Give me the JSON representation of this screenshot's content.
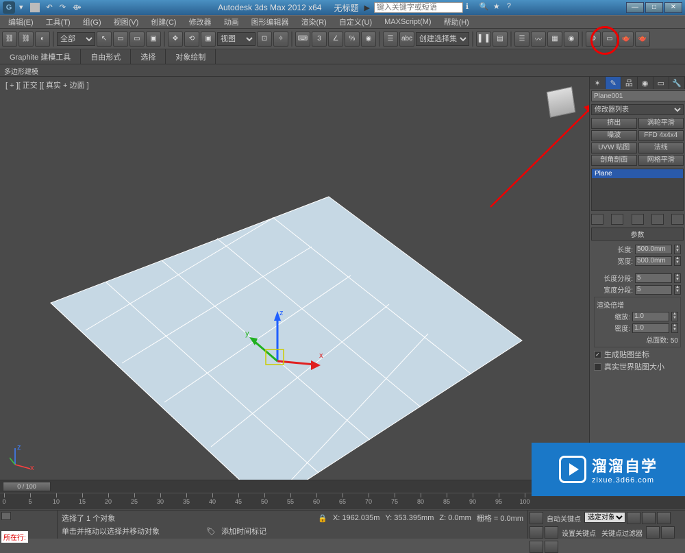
{
  "title": {
    "app": "Autodesk 3ds Max 2012 x64",
    "doc": "无标题",
    "search_placeholder": "键入关键字或短语"
  },
  "menu": [
    "编辑(E)",
    "工具(T)",
    "组(G)",
    "视图(V)",
    "创建(C)",
    "修改器",
    "动画",
    "图形编辑器",
    "渲染(R)",
    "自定义(U)",
    "MAXScript(M)",
    "帮助(H)"
  ],
  "toolbar": {
    "filter": "全部",
    "viewsel": "视图",
    "setdd": "创建选择集"
  },
  "ribbon": {
    "tabs": [
      "Graphite 建模工具",
      "自由形式",
      "选择",
      "对象绘制"
    ],
    "sub": "多边形建模"
  },
  "viewport": {
    "label": "[ + ][ 正交 ][ 真实 + 边面 ]"
  },
  "panel": {
    "objname": "Plane001",
    "modlist": "修改器列表",
    "mods": [
      "挤出",
      "涡轮平滑",
      "噪波",
      "FFD 4x4x4",
      "UVW 贴图",
      "法线",
      "剖角剖面",
      "网格平滑"
    ],
    "stack_sel": "Plane",
    "roll_title": "参数",
    "length_l": "长度:",
    "length_v": "500.0mm",
    "width_l": "宽度:",
    "width_v": "500.0mm",
    "lseg_l": "长度分段:",
    "lseg_v": "5",
    "wseg_l": "宽度分段:",
    "wseg_v": "5",
    "render_title": "渲染倍增",
    "scale_l": "缩放:",
    "scale_v": "1.0",
    "density_l": "密度:",
    "density_v": "1.0",
    "total_l": "总面数: 50",
    "gen_map": "生成贴图坐标",
    "real_world": "真实世界贴图大小"
  },
  "time": {
    "slider": "0 / 100",
    "ticks": [
      0,
      5,
      10,
      15,
      20,
      25,
      30,
      35,
      40,
      45,
      50,
      55,
      60,
      65,
      70,
      75,
      80,
      85,
      90,
      95,
      100
    ]
  },
  "status": {
    "tag": "所在行:",
    "sel": "选择了 1 个对象",
    "hint": "单击并拖动以选择并移动对象",
    "x": "X: 1962.035m",
    "y": "Y: 353.395mm",
    "z": "Z: 0.0mm",
    "grid": "栅格 = 0.0mm",
    "addtag": "添加时间标记",
    "autokey": "自动关键点",
    "setkey": "设置关键点",
    "keyfilter": "关键点过滤器",
    "selset": "选定对象"
  },
  "watermark": {
    "big": "溜溜自学",
    "small": "zixue.3d66.com"
  }
}
